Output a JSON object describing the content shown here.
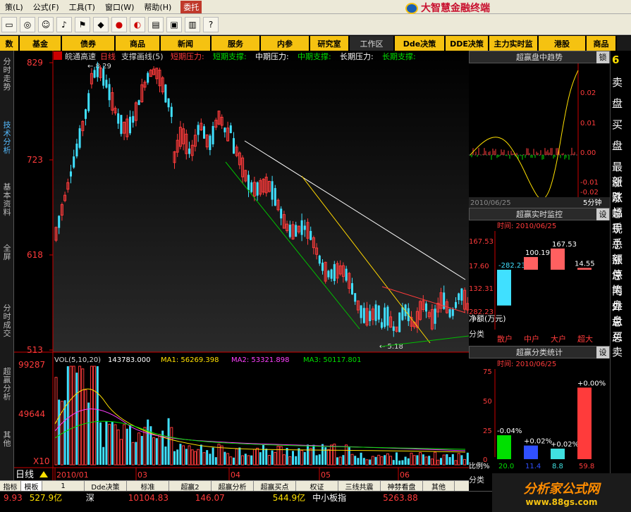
{
  "menu": {
    "items": [
      "策(L)",
      "公式(F)",
      "工具(T)",
      "窗口(W)",
      "帮助(H)"
    ],
    "weituo": "委托"
  },
  "brand": "大智慧金融终端",
  "navbar": {
    "items": [
      "数",
      "基金",
      "债券",
      "商品",
      "新闻",
      "服务",
      "内参",
      "研究室",
      "工作区",
      "Dde决策",
      "DDE决策",
      "主力实时监",
      "港股",
      "商品"
    ]
  },
  "lefttabs": [
    "分时走势",
    "技术分析",
    "基本资料",
    "全屏",
    "分时成交",
    "超赢分析",
    "其他"
  ],
  "chart": {
    "header": {
      "stock": "皖通高速",
      "period": "日线",
      "indicator": "支撑画线(5)",
      "labels": [
        {
          "t": "短期压力:",
          "c": "#ff3b3b"
        },
        {
          "t": "短期支撑:",
          "c": "#00e000"
        },
        {
          "t": "中期压力:",
          "c": "#ffffff"
        },
        {
          "t": "中期支撑:",
          "c": "#00e000"
        },
        {
          "t": "长期压力:",
          "c": "#ffffff"
        },
        {
          "t": "长期支撑:",
          "c": "#00e000"
        }
      ]
    },
    "price_axis": [
      "829",
      "723",
      "618",
      "513"
    ],
    "hi_label": "8.29",
    "lo_label": "5.18",
    "vol_header": {
      "name": "VOL(5,10,20)",
      "value": "143783.000",
      "ma1": "MA1: 56269.398",
      "ma2": "MA2: 53321.898",
      "ma3": "MA3: 50117.801"
    },
    "vol_axis": [
      "99287",
      "49644",
      "X10"
    ],
    "period_label": "日线",
    "date_labels": [
      "2010/01",
      "03",
      "04",
      "05",
      "06"
    ]
  },
  "bottom_tabs": [
    "指标",
    "模板",
    "1",
    "Dde决策",
    "标准",
    "超赢2",
    "超赢分析",
    "超赢买点",
    "权证",
    "三线共震",
    "神棼看盘",
    "其他"
  ],
  "status": {
    "v1": "9.93",
    "v2": "527.9亿",
    "v3": "深",
    "v4": "10104.83",
    "v5": "146.07",
    "v6": "544.9亿",
    "v7": "中小板指",
    "v8": "5263.88"
  },
  "right": {
    "p1": {
      "title": "超赢盘中趋势",
      "lock": "锁",
      "date": "2010/06/25",
      "period": "5分钟",
      "axis": [
        "0.02",
        "0.01",
        "0.00",
        "-0.01",
        "-0.02"
      ]
    },
    "p2": {
      "title": "超赢实时监控",
      "btn": "设",
      "time": "时间: 2010/06/25",
      "axis": [
        "167.53",
        "17.60",
        "132.31",
        "282.23"
      ],
      "unit": "净额(万元)",
      "cats": [
        "散户",
        "中户",
        "大户",
        "超大"
      ],
      "values": [
        -282.23,
        100.19,
        167.53,
        14.55
      ],
      "labels": [
        "-282.23",
        "100.19",
        "167.53",
        "14.55"
      ],
      "fenlei": "分类"
    },
    "p3": {
      "title": "超赢分类统计",
      "btn": "设",
      "time": "时间: 2010/06/25",
      "axis": [
        "75",
        "50",
        "25",
        "0"
      ],
      "pct_labels": [
        "-0.04%",
        "+0.02%",
        "+0.02%",
        "+0.00%"
      ],
      "values": [
        20.0,
        11.4,
        8.8,
        59.8
      ],
      "val_labels": [
        "20.0",
        "11.4",
        "8.8",
        "59.8"
      ],
      "colors": [
        "#00e000",
        "#3050ff",
        "#40e0e0",
        "#ff3b3b"
      ],
      "bili": "比例%",
      "fenlei": "分类"
    }
  },
  "farright": [
    "6",
    "卖",
    "盘",
    "买",
    "盘",
    "最新",
    "涨跌",
    "涨幅",
    "总手",
    "现手",
    "总额",
    "涨停",
    "总笔",
    "内盘",
    "外盘",
    "总买",
    "总卖"
  ],
  "watermark": {
    "t1": "分析家公式网",
    "t2": "www.88gs.com"
  }
}
